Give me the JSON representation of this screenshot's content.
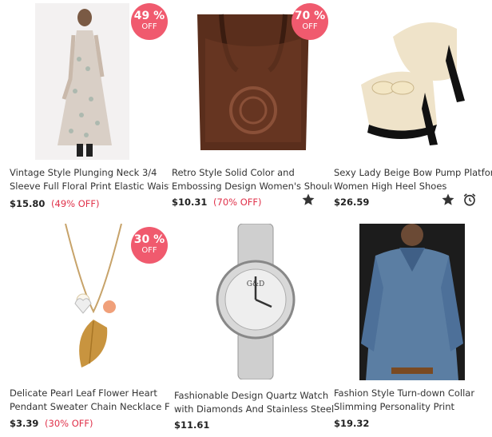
{
  "products": [
    {
      "title_line1": "Vintage Style Plunging Neck 3/4",
      "title_line2": "Sleeve Full Floral Print Elastic Waist",
      "price": "$15.80",
      "discount": "(49% OFF)",
      "badge_pct": "49 %",
      "badge_off": "OFF",
      "image": "floral-maxi-dress"
    },
    {
      "title_line1": "Retro Style Solid Color and",
      "title_line2": "Embossing Design Women's Shoulder",
      "price": "$10.31",
      "discount": "(70% OFF)",
      "badge_pct": "70 %",
      "badge_off": "OFF",
      "image": "brown-leather-tote-bag",
      "icons": [
        "star-icon"
      ]
    },
    {
      "title_line1": "Sexy Lady Beige Bow Pump Platform",
      "title_line2": "Women High Heel Shoes",
      "price": "$26.59",
      "image": "beige-bow-high-heel-pumps",
      "icons": [
        "star-icon",
        "alarm-clock-icon"
      ]
    },
    {
      "title_line1": "Delicate Pearl Leaf Flower Heart",
      "title_line2": "Pendant Sweater Chain Necklace For",
      "price": "$3.39",
      "discount": "(30% OFF)",
      "badge_pct": "30 %",
      "badge_off": "OFF",
      "image": "leaf-pendant-necklace"
    },
    {
      "title_line1": "Fashionable Design Quartz Watch",
      "title_line2": "with Diamonds And Stainless Steel",
      "price": "$11.61",
      "image": "silver-quartz-watch"
    },
    {
      "title_line1": "Fashion Style Turn-down Collar",
      "title_line2": "Slimming Personality Print",
      "price": "$19.32",
      "image": "denim-shirt"
    }
  ],
  "colors": {
    "badge": "#f05a6e",
    "discount_text": "#e0314a"
  }
}
